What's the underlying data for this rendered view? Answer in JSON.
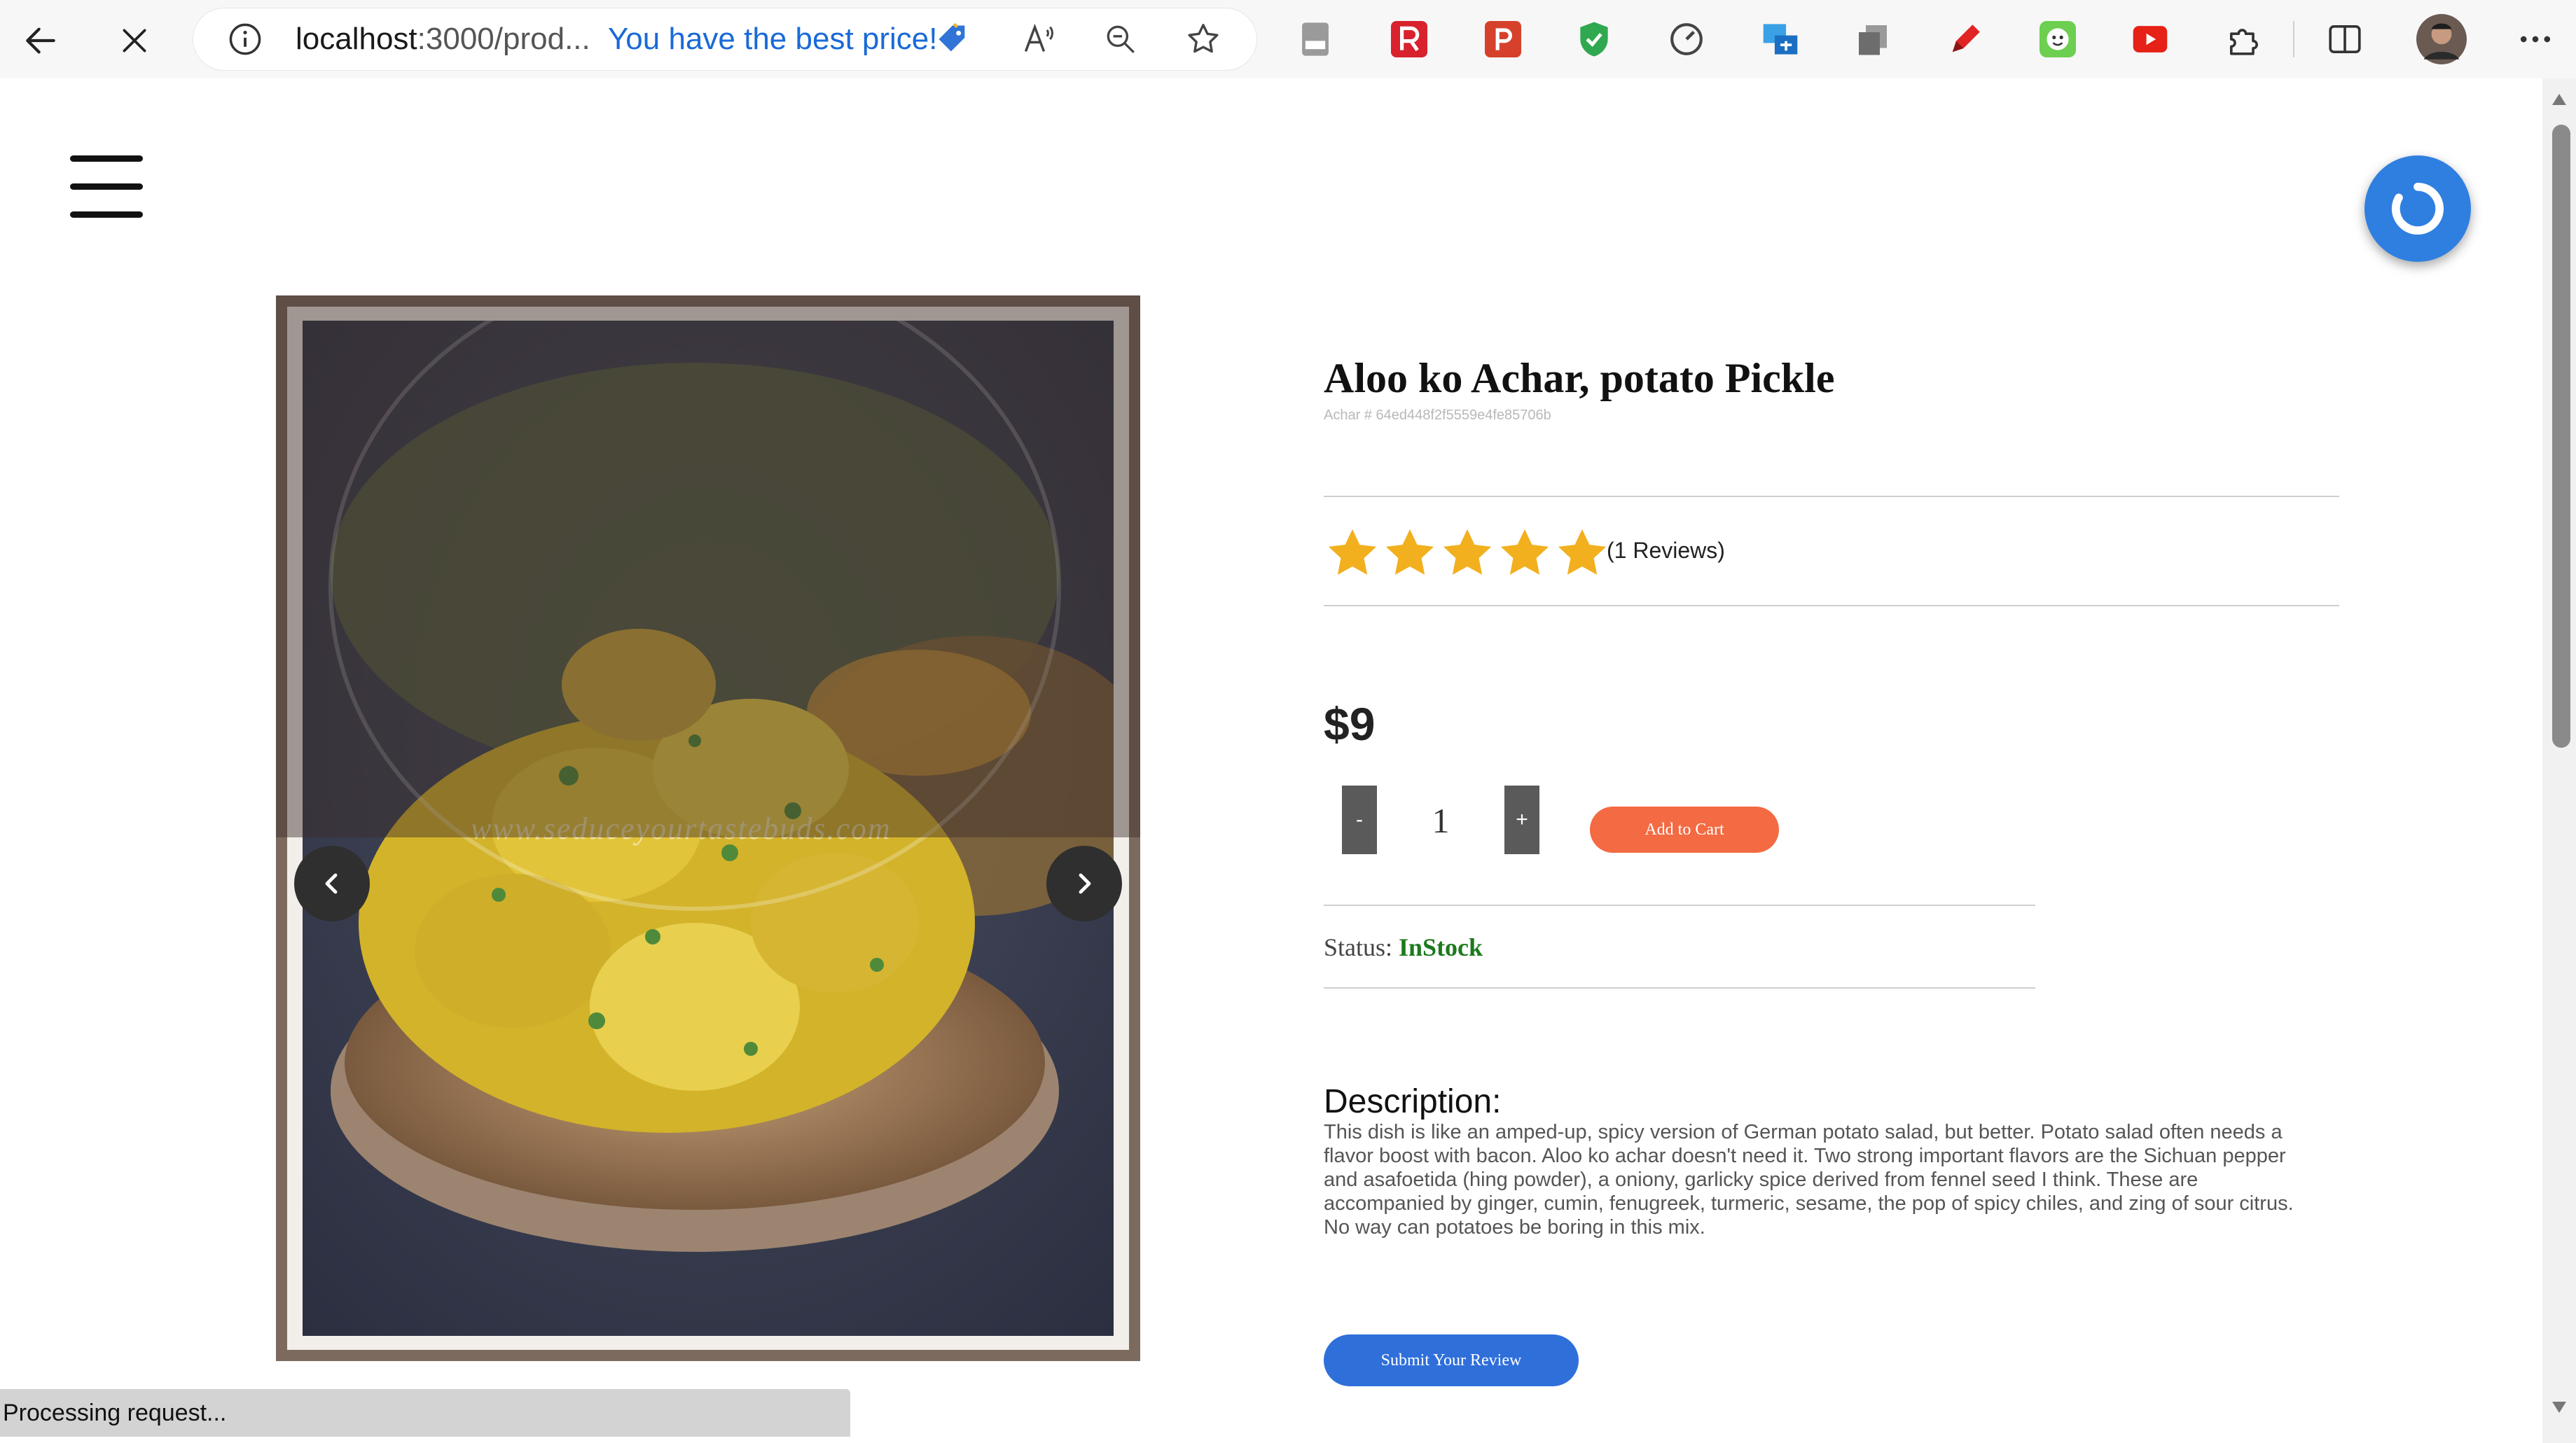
{
  "browser": {
    "url_host": "localhost",
    "url_rest": ":3000/prod...",
    "price_tag": "You have the best price!",
    "icons": [
      "back-arrow-icon",
      "stop-loading-icon",
      "info-icon",
      "price-tag-icon",
      "read-aloud-icon",
      "zoom-icon",
      "favorite-star-icon",
      "pdf-icon",
      "extension-r-icon",
      "extension-p-icon",
      "shield-icon",
      "speed-gauge-icon",
      "screen-translate-icon",
      "copy-icon",
      "pen-icon",
      "smiley-icon",
      "youtube-icon",
      "extensions-puzzle-icon",
      "split-screen-icon",
      "profile-avatar",
      "more-menu-icon"
    ]
  },
  "product": {
    "title": "Aloo ko Achar, potato Pickle",
    "id_line": "Achar # 64ed448f2f5559e4fe85706b",
    "rating": 5,
    "reviews": "(1 Reviews)",
    "price": "$9",
    "qty_minus": "-",
    "qty_value": "1",
    "qty_plus": "+",
    "add_to_cart": "Add to Cart",
    "status_label": "Status: ",
    "status_value": "InStock",
    "description_heading": "Description:",
    "description": "This dish is like an amped-up, spicy version of German potato salad, but better. Potato salad often needs a flavor boost with bacon. Aloo ko achar doesn't need it. Two strong important flavors are the Sichuan pepper and asafoetida (hing powder), a oniony, garlicky spice derived from fennel seed I think. These are accompanied by ginger, cumin, fenugreek, turmeric, sesame, the pop of spicy chiles, and zing of sour citrus. No way can potatoes be boring in this mix.",
    "submit_review": "Submit Your Review"
  },
  "carousel": {
    "watermark": "www.seduceyourtastebuds.com"
  },
  "status_bar": "Processing request...",
  "colors": {
    "star": "#f2b01e",
    "add_to_cart": "#f36a43",
    "submit_review": "#2f6fda",
    "in_stock": "#1c7a1c",
    "loader": "#2f7fe0"
  }
}
